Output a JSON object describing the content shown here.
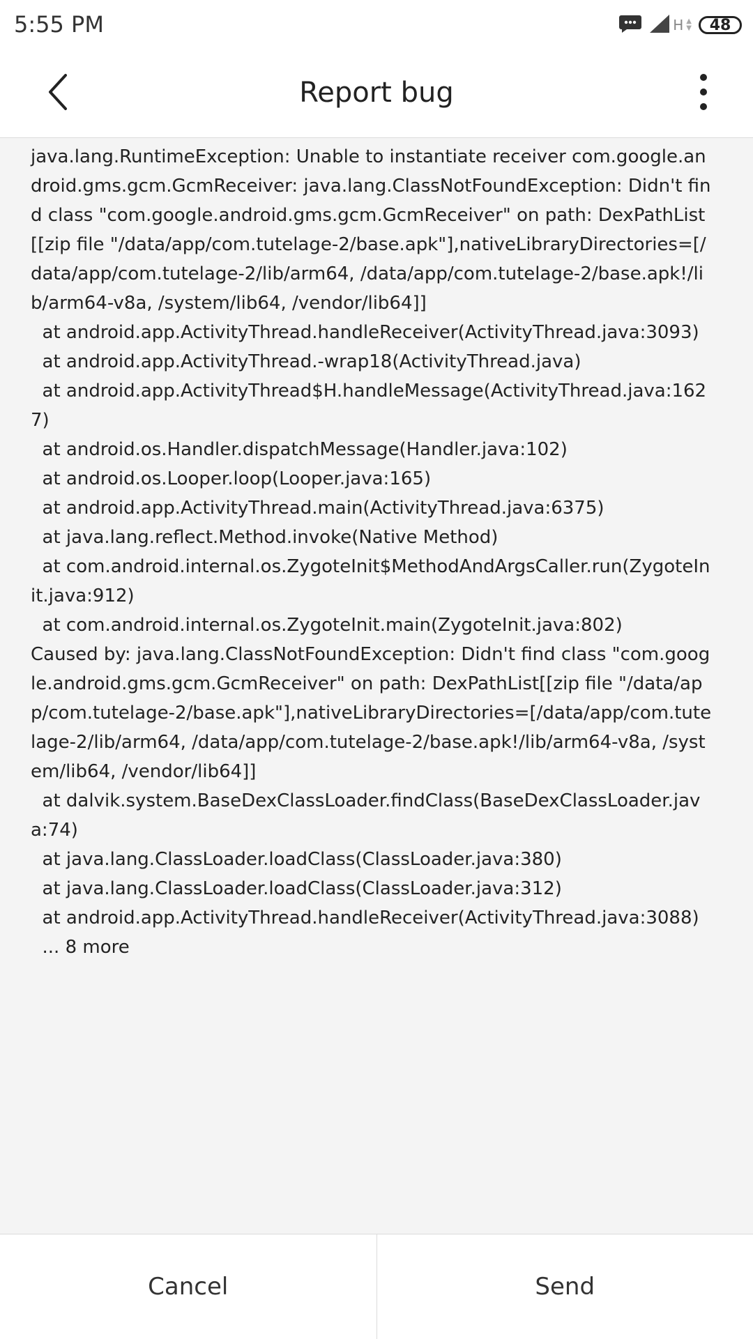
{
  "status_bar": {
    "time": "5:55 PM",
    "network_type": "H",
    "battery_level": "48",
    "icons": [
      "message-icon",
      "signal-icon",
      "battery-icon"
    ]
  },
  "header": {
    "title": "Report bug",
    "icons": [
      "back-arrow-icon",
      "more-vertical-icon"
    ]
  },
  "content": {
    "log": "java.lang.RuntimeException: Unable to instantiate receiver com.google.android.gms.gcm.GcmReceiver: java.lang.ClassNotFoundException: Didn't find class \"com.google.android.gms.gcm.GcmReceiver\" on path: DexPathList[[zip file \"/data/app/com.tutelage-2/base.apk\"],nativeLibraryDirectories=[/data/app/com.tutelage-2/lib/arm64, /data/app/com.tutelage-2/base.apk!/lib/arm64-v8a, /system/lib64, /vendor/lib64]]\n  at android.app.ActivityThread.handleReceiver(ActivityThread.java:3093)\n  at android.app.ActivityThread.-wrap18(ActivityThread.java)\n  at android.app.ActivityThread$H.handleMessage(ActivityThread.java:1627)\n  at android.os.Handler.dispatchMessage(Handler.java:102)\n  at android.os.Looper.loop(Looper.java:165)\n  at android.app.ActivityThread.main(ActivityThread.java:6375)\n  at java.lang.reflect.Method.invoke(Native Method)\n  at com.android.internal.os.ZygoteInit$MethodAndArgsCaller.run(ZygoteInit.java:912)\n  at com.android.internal.os.ZygoteInit.main(ZygoteInit.java:802)\nCaused by: java.lang.ClassNotFoundException: Didn't find class \"com.google.android.gms.gcm.GcmReceiver\" on path: DexPathList[[zip file \"/data/app/com.tutelage-2/base.apk\"],nativeLibraryDirectories=[/data/app/com.tutelage-2/lib/arm64, /data/app/com.tutelage-2/base.apk!/lib/arm64-v8a, /system/lib64, /vendor/lib64]]\n  at dalvik.system.BaseDexClassLoader.findClass(BaseDexClassLoader.java:74)\n  at java.lang.ClassLoader.loadClass(ClassLoader.java:380)\n  at java.lang.ClassLoader.loadClass(ClassLoader.java:312)\n  at android.app.ActivityThread.handleReceiver(ActivityThread.java:3088)\n  ... 8 more"
  },
  "footer": {
    "cancel_label": "Cancel",
    "send_label": "Send"
  },
  "colors": {
    "background": "#f4f4f4",
    "surface": "#ffffff",
    "text": "#222222",
    "divider": "#dcdcdc"
  }
}
